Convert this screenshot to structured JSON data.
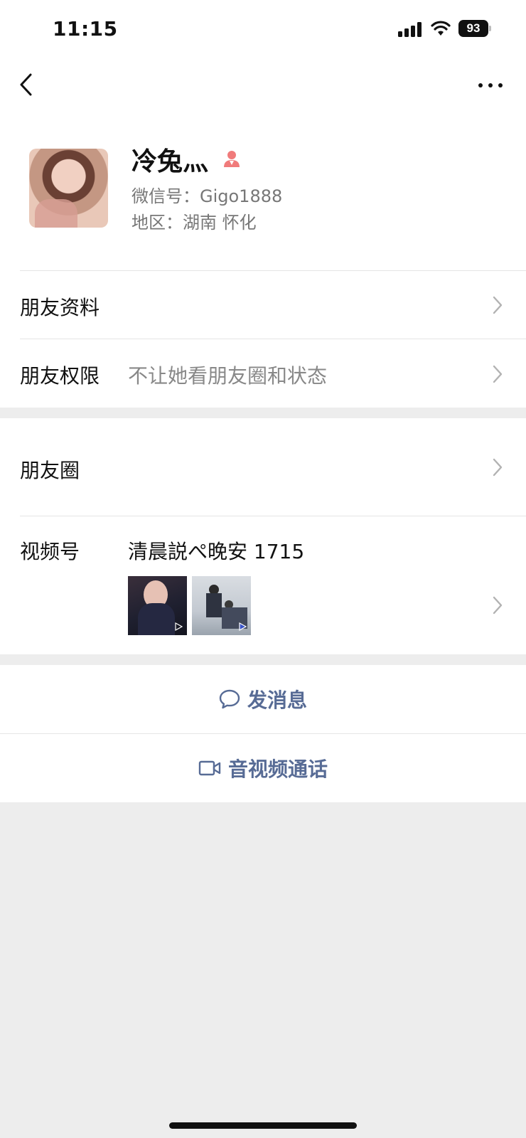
{
  "status_bar": {
    "time": "11:15",
    "battery": "93"
  },
  "profile": {
    "name": "冷兔灬",
    "wechat_id": "微信号：Gigo1888",
    "region": "地区：湖南 怀化"
  },
  "rows": {
    "friend_info": {
      "label": "朋友资料"
    },
    "permissions": {
      "label": "朋友权限",
      "value": "不让她看朋友圈和状态"
    },
    "moments": {
      "label": "朋友圈"
    },
    "channels": {
      "label": "视频号",
      "value": "清晨説ぺ晚安 1715"
    }
  },
  "actions": {
    "message": "发消息",
    "call": "音视频通话"
  },
  "colors": {
    "link": "#576b95",
    "background": "#ededed",
    "badge": "#f07b7b"
  },
  "icons": [
    "back-icon",
    "more-icon",
    "person-badge-icon",
    "chevron-right-icon",
    "chat-bubble-icon",
    "video-camera-icon",
    "play-icon"
  ]
}
